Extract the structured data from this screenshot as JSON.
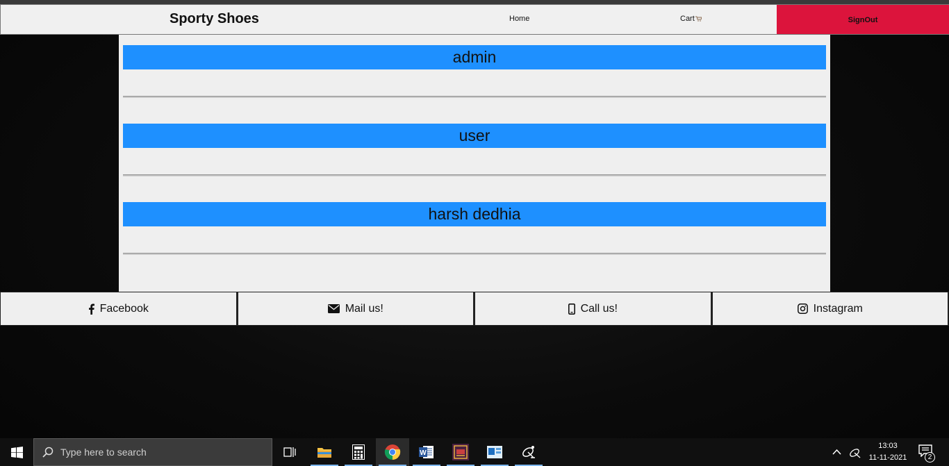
{
  "navbar": {
    "brand": "Sporty Shoes",
    "home": "Home",
    "cart": "Cart",
    "signout": "SignOut"
  },
  "users": [
    "admin",
    "user",
    "harsh dedhia"
  ],
  "footer": {
    "facebook": "Facebook",
    "mail": "Mail us!",
    "call": "Call us!",
    "instagram": "Instagram"
  },
  "taskbar": {
    "search_placeholder": "Type here to search",
    "time": "13:03",
    "date": "11-11-2021",
    "notification_count": "2",
    "icons": [
      "windows-start-icon",
      "task-view-icon",
      "file-explorer-icon",
      "calculator-icon",
      "chrome-icon",
      "word-icon",
      "app-icon",
      "outlook-icon",
      "satellite-icon"
    ]
  },
  "colors": {
    "user_bar": "#1e90ff",
    "signout": "#dc143c"
  }
}
